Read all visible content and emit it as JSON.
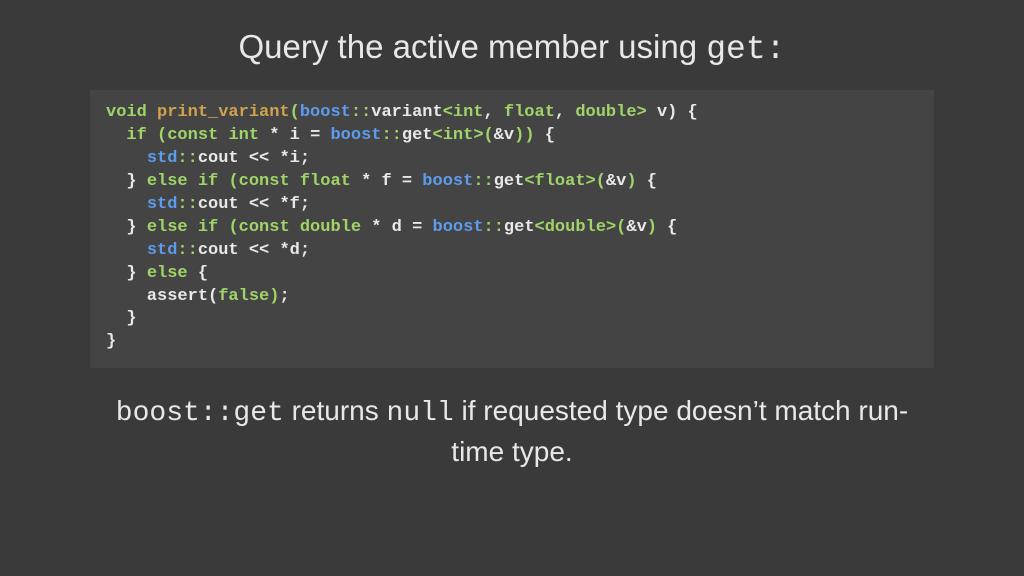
{
  "title": {
    "prefix": "Query the active member using ",
    "mono": "get",
    "suffix": ":"
  },
  "code": {
    "tokens": [
      [
        [
          "c-kw",
          "void"
        ],
        [
          "c-id",
          " "
        ],
        [
          "c-fn",
          "print_variant"
        ],
        [
          "c-op",
          "("
        ],
        [
          "c-ns",
          "boost"
        ],
        [
          "c-op",
          "::"
        ],
        [
          "c-call",
          "variant"
        ],
        [
          "c-op",
          "<"
        ],
        [
          "c-kw",
          "int"
        ],
        [
          "c-opw",
          ", "
        ],
        [
          "c-kw",
          "float"
        ],
        [
          "c-opw",
          ", "
        ],
        [
          "c-kw",
          "double"
        ],
        [
          "c-op",
          ">"
        ],
        [
          "c-id",
          " v) {"
        ]
      ],
      [
        [
          "c-id",
          "  "
        ],
        [
          "c-kw",
          "if"
        ],
        [
          "c-id",
          " "
        ],
        [
          "c-op",
          "("
        ],
        [
          "c-kw",
          "const"
        ],
        [
          "c-id",
          " "
        ],
        [
          "c-kw",
          "int"
        ],
        [
          "c-id",
          " "
        ],
        [
          "c-opw",
          "*"
        ],
        [
          "c-id",
          " i "
        ],
        [
          "c-opw",
          "="
        ],
        [
          "c-id",
          " "
        ],
        [
          "c-ns",
          "boost"
        ],
        [
          "c-op",
          "::"
        ],
        [
          "c-call",
          "get"
        ],
        [
          "c-op",
          "<"
        ],
        [
          "c-kw",
          "int"
        ],
        [
          "c-op",
          ">("
        ],
        [
          "c-opw",
          "&"
        ],
        [
          "c-id",
          "v"
        ],
        [
          "c-op",
          "))"
        ],
        [
          "c-id",
          " {"
        ]
      ],
      [
        [
          "c-id",
          "    "
        ],
        [
          "c-ns",
          "std"
        ],
        [
          "c-op",
          "::"
        ],
        [
          "c-call",
          "cout"
        ],
        [
          "c-id",
          " "
        ],
        [
          "c-opw",
          "<<"
        ],
        [
          "c-id",
          " "
        ],
        [
          "c-opw",
          "*"
        ],
        [
          "c-id",
          "i;"
        ]
      ],
      [
        [
          "c-id",
          "  } "
        ],
        [
          "c-kw",
          "else"
        ],
        [
          "c-id",
          " "
        ],
        [
          "c-kw",
          "if"
        ],
        [
          "c-id",
          " "
        ],
        [
          "c-op",
          "("
        ],
        [
          "c-kw",
          "const"
        ],
        [
          "c-id",
          " "
        ],
        [
          "c-kw",
          "float"
        ],
        [
          "c-id",
          " "
        ],
        [
          "c-opw",
          "*"
        ],
        [
          "c-id",
          " f "
        ],
        [
          "c-opw",
          "="
        ],
        [
          "c-id",
          " "
        ],
        [
          "c-ns",
          "boost"
        ],
        [
          "c-op",
          "::"
        ],
        [
          "c-call",
          "get"
        ],
        [
          "c-op",
          "<"
        ],
        [
          "c-kw",
          "float"
        ],
        [
          "c-op",
          ">("
        ],
        [
          "c-opw",
          "&"
        ],
        [
          "c-id",
          "v"
        ],
        [
          "c-op",
          ")"
        ],
        [
          "c-id",
          " {"
        ]
      ],
      [
        [
          "c-id",
          "    "
        ],
        [
          "c-ns",
          "std"
        ],
        [
          "c-op",
          "::"
        ],
        [
          "c-call",
          "cout"
        ],
        [
          "c-id",
          " "
        ],
        [
          "c-opw",
          "<<"
        ],
        [
          "c-id",
          " "
        ],
        [
          "c-opw",
          "*"
        ],
        [
          "c-id",
          "f;"
        ]
      ],
      [
        [
          "c-id",
          "  } "
        ],
        [
          "c-kw",
          "else"
        ],
        [
          "c-id",
          " "
        ],
        [
          "c-kw",
          "if"
        ],
        [
          "c-id",
          " "
        ],
        [
          "c-op",
          "("
        ],
        [
          "c-kw",
          "const"
        ],
        [
          "c-id",
          " "
        ],
        [
          "c-kw",
          "double"
        ],
        [
          "c-id",
          " "
        ],
        [
          "c-opw",
          "*"
        ],
        [
          "c-id",
          " d "
        ],
        [
          "c-opw",
          "="
        ],
        [
          "c-id",
          " "
        ],
        [
          "c-ns",
          "boost"
        ],
        [
          "c-op",
          "::"
        ],
        [
          "c-call",
          "get"
        ],
        [
          "c-op",
          "<"
        ],
        [
          "c-kw",
          "double"
        ],
        [
          "c-op",
          ">("
        ],
        [
          "c-opw",
          "&"
        ],
        [
          "c-id",
          "v"
        ],
        [
          "c-op",
          ")"
        ],
        [
          "c-id",
          " {"
        ]
      ],
      [
        [
          "c-id",
          "    "
        ],
        [
          "c-ns",
          "std"
        ],
        [
          "c-op",
          "::"
        ],
        [
          "c-call",
          "cout"
        ],
        [
          "c-id",
          " "
        ],
        [
          "c-opw",
          "<<"
        ],
        [
          "c-id",
          " "
        ],
        [
          "c-opw",
          "*"
        ],
        [
          "c-id",
          "d;"
        ]
      ],
      [
        [
          "c-id",
          "  } "
        ],
        [
          "c-kw",
          "else"
        ],
        [
          "c-id",
          " {"
        ]
      ],
      [
        [
          "c-id",
          "    assert("
        ],
        [
          "c-kw",
          "false"
        ],
        [
          "c-op",
          ")"
        ],
        [
          "c-id",
          ";"
        ]
      ],
      [
        [
          "c-id",
          "  }"
        ]
      ],
      [
        [
          "c-id",
          "}"
        ]
      ]
    ]
  },
  "caption": {
    "parts": [
      {
        "type": "mono",
        "text": "boost::get"
      },
      {
        "type": "plain",
        "text": " returns "
      },
      {
        "type": "mono",
        "text": "null"
      },
      {
        "type": "plain",
        "text": " if requested type doesn’t match run-time type."
      }
    ]
  }
}
